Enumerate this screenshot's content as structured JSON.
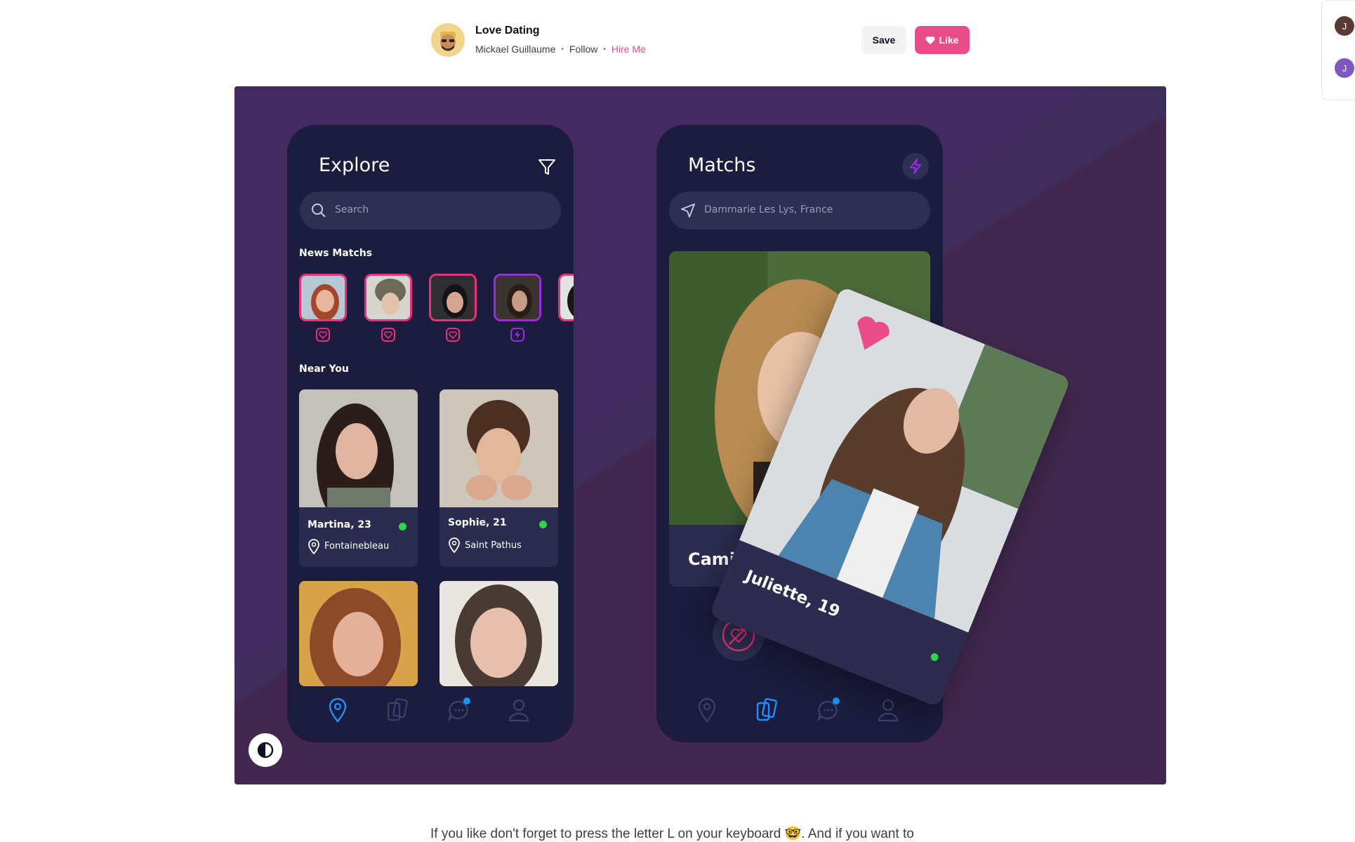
{
  "header": {
    "title": "Love Dating",
    "author": "Mickael Guillaume",
    "follow": "Follow",
    "hire": "Hire Me",
    "save_label": "Save",
    "like_label": "Like"
  },
  "rail": {
    "avatars": [
      "J",
      "J"
    ]
  },
  "explore": {
    "title": "Explore",
    "search_placeholder": "Search",
    "news_matches_label": "News Matchs",
    "near_you_label": "Near You",
    "near": [
      {
        "name": "Martina, 23",
        "location": "Fontainebleau"
      },
      {
        "name": "Sophie, 21",
        "location": "Saint Pathus"
      }
    ]
  },
  "matchs": {
    "title": "Matchs",
    "location": "Dammarie Les Lys, France",
    "cards": [
      {
        "name": "Camille, 22"
      },
      {
        "name": "Juliette, 19"
      }
    ]
  },
  "description": "If you like don't forget to press the letter L on your keyboard 🤓. And if you want to",
  "colors": {
    "accent": "#ea4c89",
    "shot_bg": "#3f2b55",
    "phone_bg": "#1b1c3e",
    "match_pink": "#e8317a",
    "match_purple": "#9b2be0",
    "tab_active": "#1e90ff",
    "online": "#2fd44a",
    "like_teal": "#1fc7a6"
  }
}
